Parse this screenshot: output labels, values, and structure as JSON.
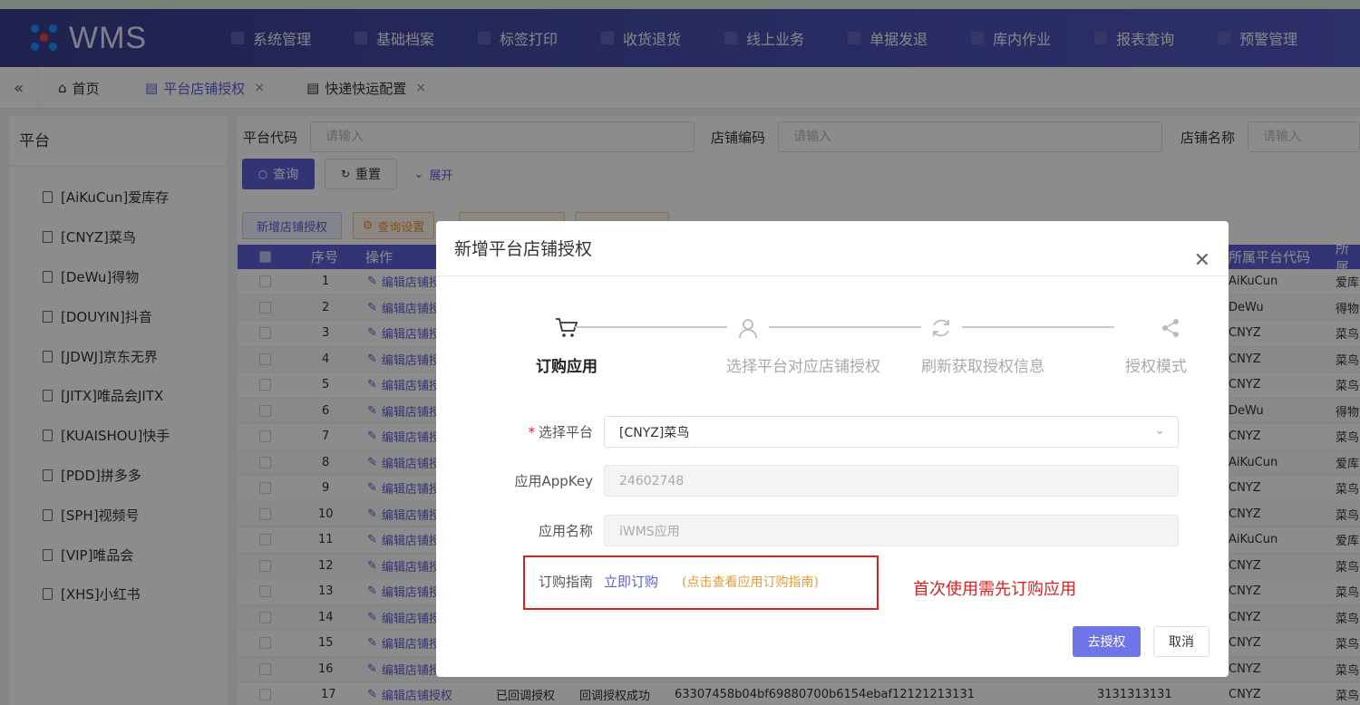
{
  "app": {
    "logo": "WMS",
    "accent": "#5b5fd6"
  },
  "nav": [
    "系统管理",
    "基础档案",
    "标签打印",
    "收货退货",
    "线上业务",
    "单据发退",
    "库内作业",
    "报表查询",
    "预警管理"
  ],
  "tabs": {
    "home": "首页",
    "t1": "平台店铺授权",
    "t2": "快递快运配置"
  },
  "sidebar": {
    "title": "平台",
    "items": [
      "[AiKuCun]爱库存",
      "[CNYZ]菜鸟",
      "[DeWu]得物",
      "[DOUYIN]抖音",
      "[JDWJ]京东无界",
      "[JITX]唯品会JITX",
      "[KUAISHOU]快手",
      "[PDD]拼多多",
      "[SPH]视频号",
      "[VIP]唯品会",
      "[XHS]小红书"
    ]
  },
  "filters": {
    "platform_code": "平台代码",
    "shop_code": "店铺编码",
    "shop_name": "店铺名称",
    "placeholder": "请输入",
    "query": "查询",
    "reset": "重置",
    "expand": "展开"
  },
  "toolbar": {
    "add": "新增店铺授权",
    "query_settings": "查询设置"
  },
  "table": {
    "headers": {
      "seq": "序号",
      "op": "操作",
      "platcode": "所属平台代码",
      "plat": "所属"
    },
    "edit_label": "编辑店铺授权",
    "rows": [
      {
        "n": "1",
        "code": "AiKuCun",
        "name": "爱库"
      },
      {
        "n": "2",
        "code": "DeWu",
        "name": "得物"
      },
      {
        "n": "3",
        "code": "CNYZ",
        "name": "菜鸟"
      },
      {
        "n": "4",
        "code": "CNYZ",
        "name": "菜鸟"
      },
      {
        "n": "5",
        "code": "CNYZ",
        "name": "菜鸟"
      },
      {
        "n": "6",
        "code": "DeWu",
        "name": "得物"
      },
      {
        "n": "7",
        "code": "CNYZ",
        "name": "菜鸟"
      },
      {
        "n": "8",
        "code": "AiKuCun",
        "name": "爱库"
      },
      {
        "n": "9",
        "code": "CNYZ",
        "name": "菜鸟"
      },
      {
        "n": "10",
        "code": "CNYZ",
        "name": "菜鸟"
      },
      {
        "n": "11",
        "code": "AiKuCun",
        "name": "爱库"
      },
      {
        "n": "12",
        "code": "CNYZ",
        "name": "菜鸟"
      },
      {
        "n": "13",
        "code": "CNYZ",
        "name": "菜鸟"
      },
      {
        "n": "14",
        "code": "CNYZ",
        "name": "菜鸟"
      },
      {
        "n": "15",
        "code": "CNYZ",
        "name": "菜鸟"
      },
      {
        "n": "16",
        "code": "CNYZ",
        "name": "菜鸟"
      }
    ],
    "last_row": {
      "n": "17",
      "status1": "已回调授权",
      "status2": "回调授权成功",
      "token": "63307458b04bf69880700b6154ebaf",
      "num1": "12121213131",
      "num2": "3131313131",
      "code": "CNYZ",
      "name": "菜鸟"
    }
  },
  "modal": {
    "title": "新增平台店铺授权",
    "steps": [
      "订购应用",
      "选择平台对应店铺授权",
      "刷新获取授权信息",
      "授权模式"
    ],
    "fields": {
      "platform_label": "选择平台",
      "platform_value": "[CNYZ]菜鸟",
      "appkey_label": "应用AppKey",
      "appkey_value": "24602748",
      "appname_label": "应用名称",
      "appname_value": "iWMS应用",
      "guide_label": "订购指南",
      "guide_link": "立即订购",
      "guide_hint": "(点击查看应用订购指南)"
    },
    "annotation": "首次使用需先订购应用",
    "confirm": "去授权",
    "cancel": "取消"
  }
}
